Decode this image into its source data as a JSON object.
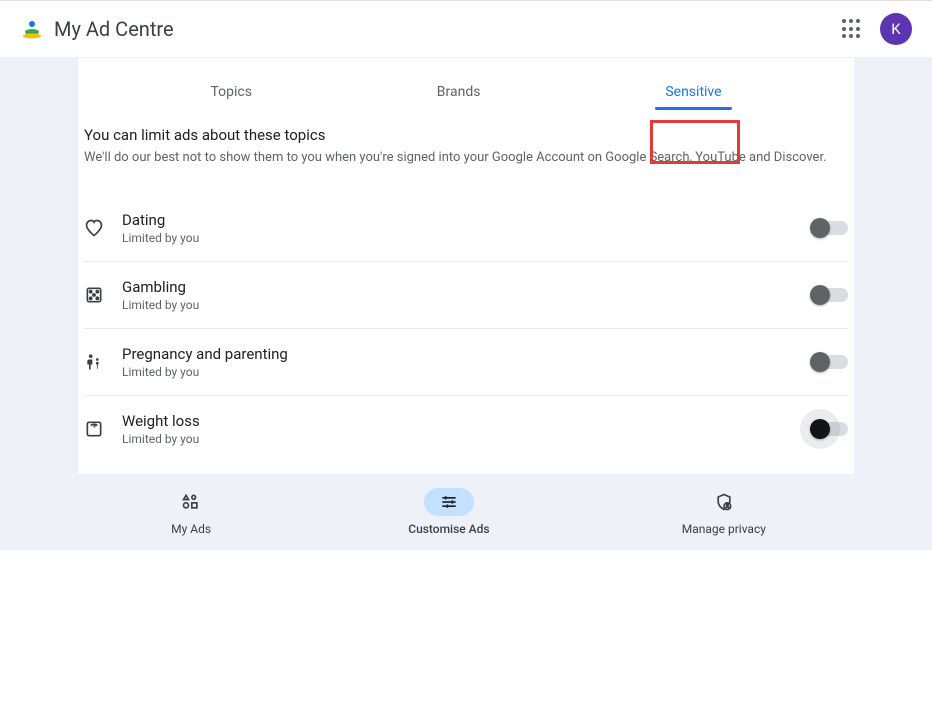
{
  "header": {
    "title": "My Ad Centre",
    "avatar_letter": "K"
  },
  "tabs": [
    {
      "label": "Topics",
      "active": false
    },
    {
      "label": "Brands",
      "active": false
    },
    {
      "label": "Sensitive",
      "active": true
    }
  ],
  "section": {
    "title": "You can limit ads about these topics",
    "subtitle": "We'll do our best not to show them to you when you're signed into your Google Account on Google Search, YouTube and Discover."
  },
  "topics": [
    {
      "icon": "heart",
      "title": "Dating",
      "status": "Limited by you"
    },
    {
      "icon": "dice",
      "title": "Gambling",
      "status": "Limited by you"
    },
    {
      "icon": "family",
      "title": "Pregnancy and parenting",
      "status": "Limited by you"
    },
    {
      "icon": "scale",
      "title": "Weight loss",
      "status": "Limited by you"
    }
  ],
  "bottom_nav": [
    {
      "label": "My Ads",
      "active": false
    },
    {
      "label": "Customise Ads",
      "active": true
    },
    {
      "label": "Manage privacy",
      "active": false
    }
  ]
}
